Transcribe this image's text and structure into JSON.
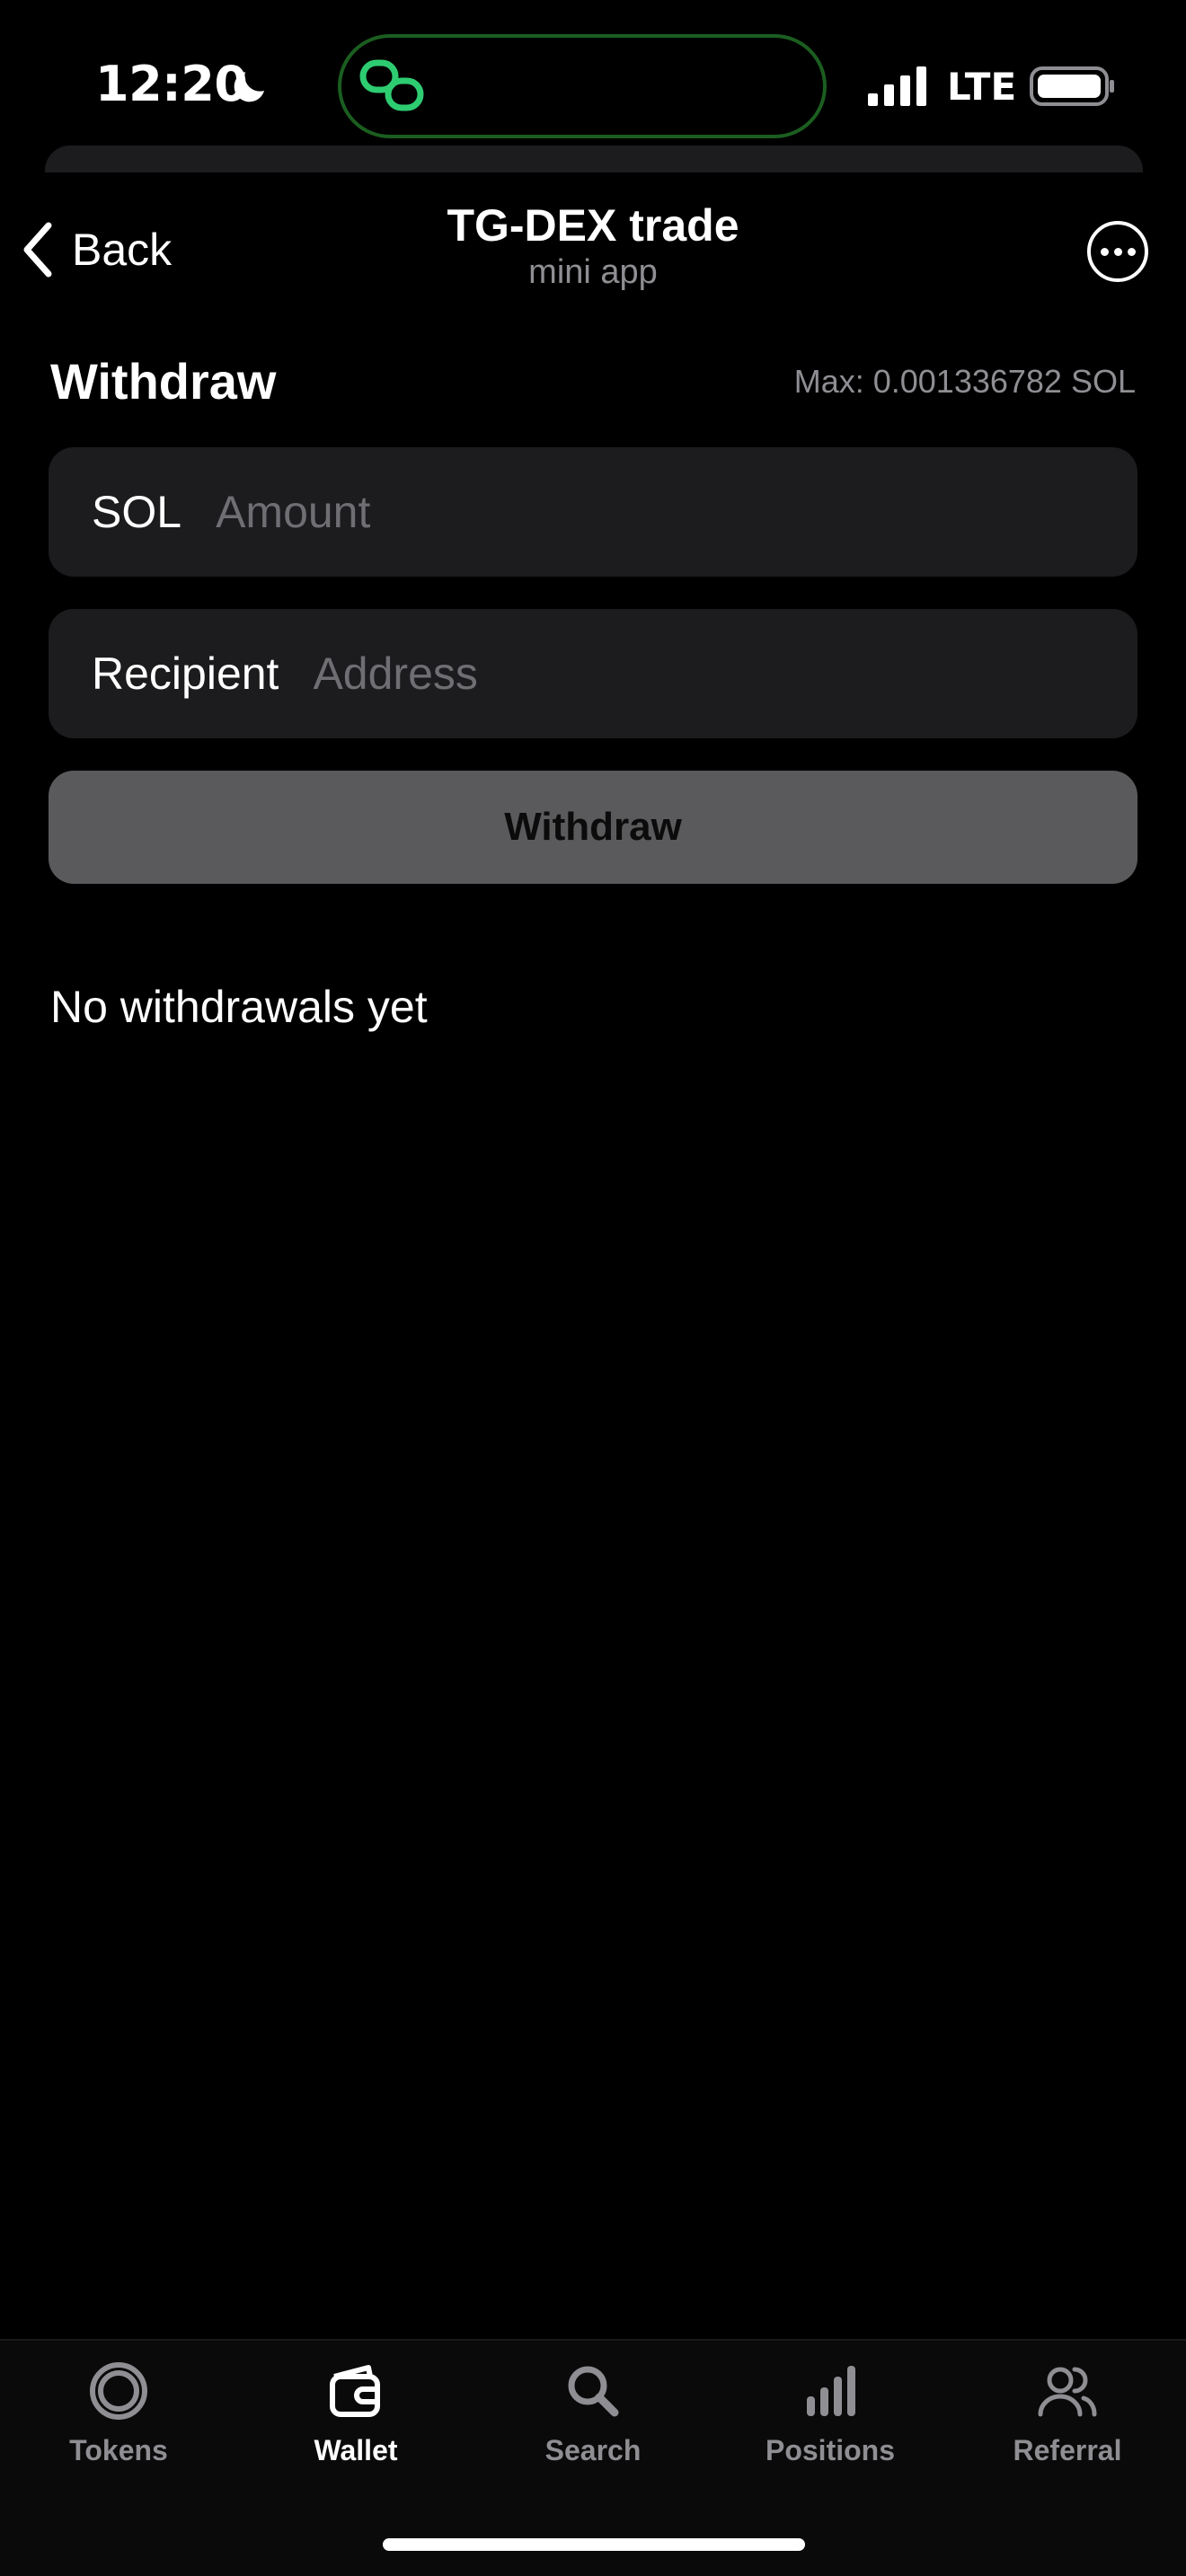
{
  "status_bar": {
    "time": "12:20",
    "network": "LTE"
  },
  "header": {
    "back_label": "Back",
    "title": "TG-DEX trade",
    "subtitle": "mini app"
  },
  "withdraw": {
    "title": "Withdraw",
    "max_label": "Max: 0.001336782 SOL",
    "amount_field": {
      "label": "SOL",
      "placeholder": "Amount",
      "value": ""
    },
    "recipient_field": {
      "label": "Recipient",
      "placeholder": "Address",
      "value": ""
    },
    "button_label": "Withdraw",
    "empty_message": "No withdrawals yet"
  },
  "tabbar": {
    "items": [
      {
        "label": "Tokens",
        "icon": "tokens-icon",
        "active": false
      },
      {
        "label": "Wallet",
        "icon": "wallet-icon",
        "active": true
      },
      {
        "label": "Search",
        "icon": "search-icon",
        "active": false
      },
      {
        "label": "Positions",
        "icon": "positions-icon",
        "active": false
      },
      {
        "label": "Referral",
        "icon": "referral-icon",
        "active": false
      }
    ]
  },
  "colors": {
    "background": "#000000",
    "field_background": "#1c1c1e",
    "button_disabled": "#5a5a5c",
    "secondary_text": "#8e8e93",
    "island_accent": "#2ecc71"
  }
}
